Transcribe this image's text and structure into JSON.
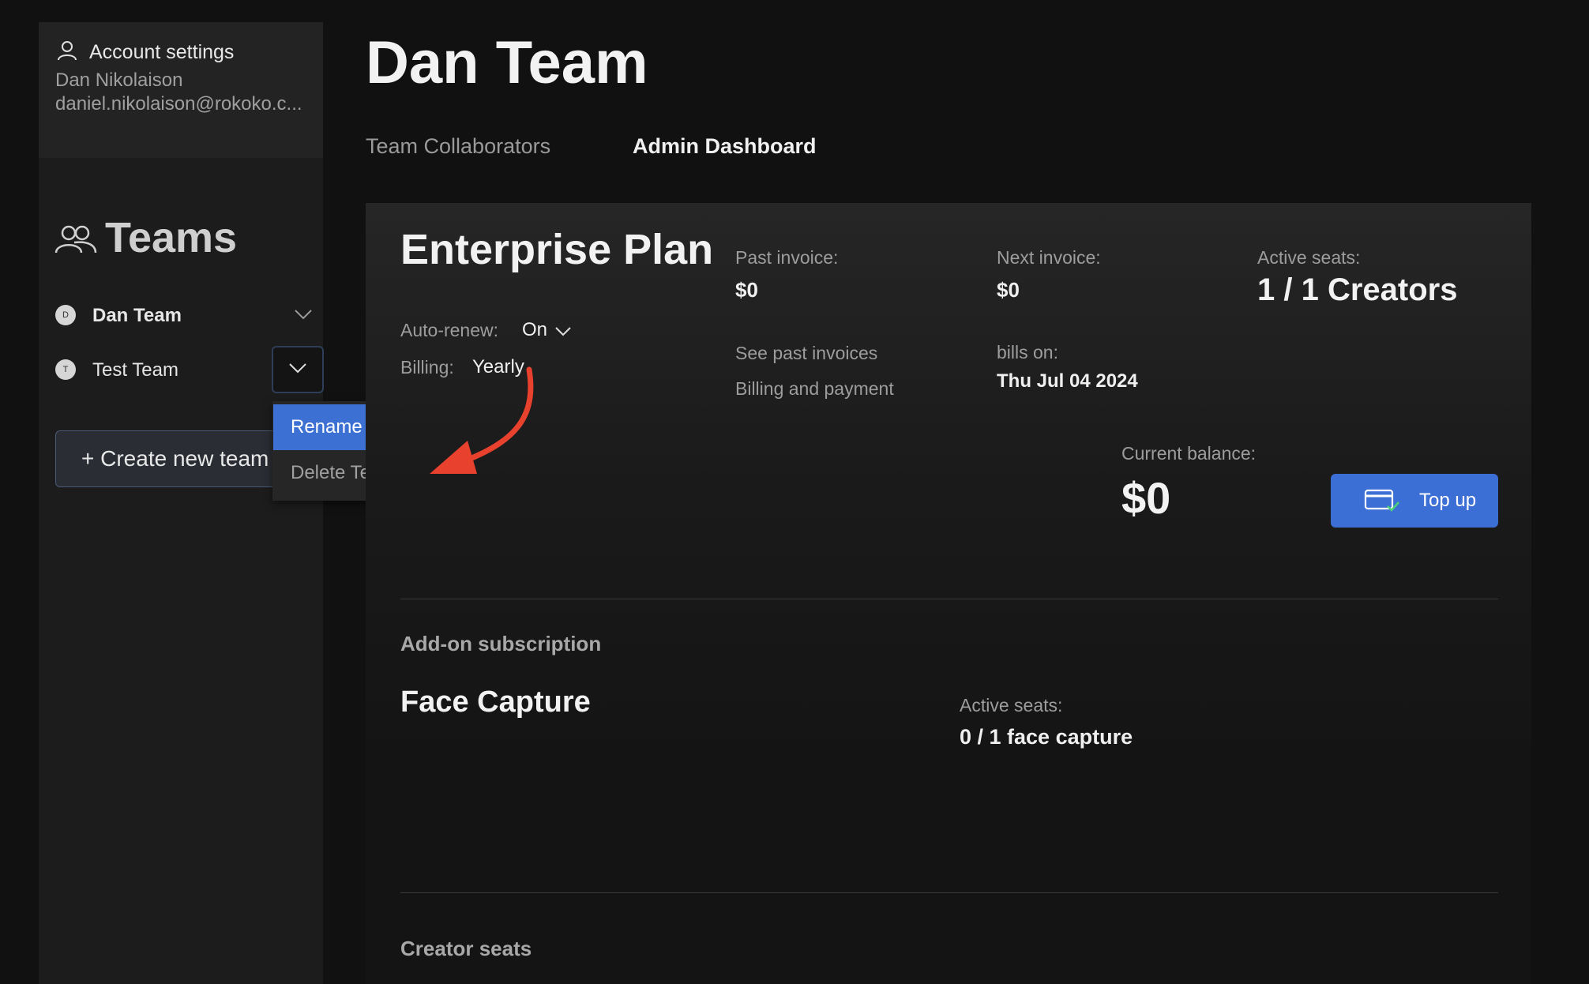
{
  "account": {
    "title": "Account settings",
    "name": "Dan Nikolaison",
    "email": "daniel.nikolaison@rokoko.c..."
  },
  "sidebar": {
    "teams_title": "Teams",
    "teams": [
      {
        "initial": "D",
        "label": "Dan Team"
      },
      {
        "initial": "T",
        "label": "Test Team"
      }
    ],
    "create_label": "+ Create new team"
  },
  "team_menu": {
    "rename": "Rename",
    "delete": "Delete Team"
  },
  "header": {
    "title": "Dan Team",
    "tabs": [
      {
        "label": "Team Collaborators",
        "active": false
      },
      {
        "label": "Admin Dashboard",
        "active": true
      }
    ]
  },
  "plan": {
    "name": "Enterprise Plan",
    "auto_renew_label": "Auto-renew:",
    "auto_renew_value": "On",
    "billing_label": "Billing:",
    "billing_value": "Yearly",
    "past_invoice_label": "Past invoice:",
    "past_invoice_value": "$0",
    "see_past_invoices": "See past invoices",
    "billing_and_payment": "Billing and payment",
    "next_invoice_label": "Next invoice:",
    "next_invoice_value": "$0",
    "bills_on_label": "bills on:",
    "bills_on_value": "Thu Jul 04 2024",
    "active_seats_label": "Active seats:",
    "active_seats_value": "1 / 1 Creators",
    "balance_label": "Current balance:",
    "balance_value": "$0",
    "topup_label": "Top up"
  },
  "addon": {
    "section_title": "Add-on subscription",
    "name": "Face Capture",
    "active_seats_label": "Active seats:",
    "active_seats_value": "0 / 1 face capture"
  },
  "creator_seats": {
    "section_title": "Creator seats"
  },
  "colors": {
    "background": "#111111",
    "sidebar": "#1c1c1c",
    "accent_blue": "#3c70d3",
    "annotation_arrow": "#e8412e"
  }
}
